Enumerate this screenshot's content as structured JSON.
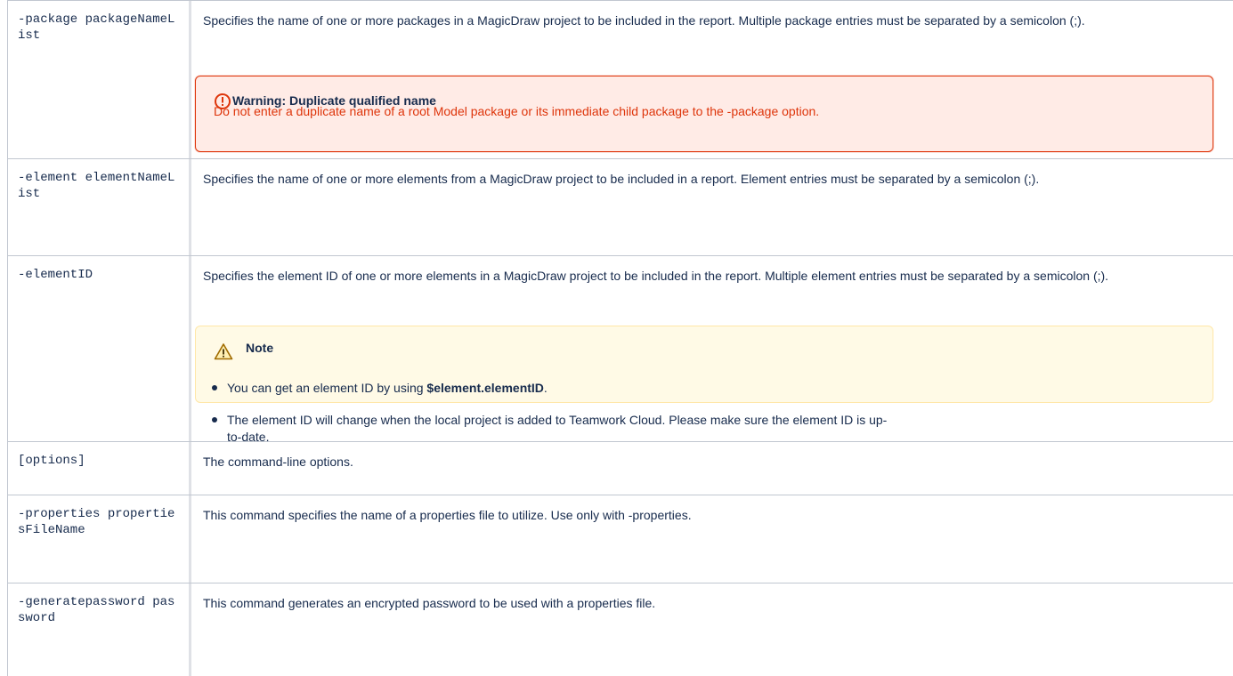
{
  "rows": [
    {
      "option": "-package packageNameList",
      "description": "Specifies the name of one or more packages in a MagicDraw project to be included in the report. Multiple package entries must be separated by a semicolon (;)."
    },
    {
      "option": "-element elementNameList",
      "description": "Specifies the name of one or more elements from a MagicDraw project to be included in a report. Element entries must be separated by a semicolon (;)."
    },
    {
      "option": "-elementID",
      "description": "Specifies the element ID of one or more elements in a MagicDraw project to be included in the report. Multiple element entries must be separated by a semicolon (;)."
    },
    {
      "option": "[options]",
      "description": "The command-line options."
    },
    {
      "option": "-properties propertiesFileName",
      "description": "This command specifies the name of a properties file to utilize. Use only with -properties."
    },
    {
      "option": "-generatepassword password",
      "description": "This command generates an encrypted password to be used with a properties file."
    }
  ],
  "warning": {
    "title": "Warning: Duplicate qualified name",
    "body": "Do not enter a duplicate name of a root Model package or its immediate child package to the -package option.",
    "icon": "error-circle-icon",
    "color": "#de350b"
  },
  "note": {
    "title": "Note",
    "icon": "warning-triangle-icon",
    "bullet1_prefix": "You can get an element ID by using ",
    "bullet1_code": "$element.elementID",
    "bullet1_suffix": ".",
    "bullet2": "The element ID will change when the local project is added to Teamwork Cloud. Please make sure the element ID is up-",
    "bullet2_tail": "to-date."
  }
}
